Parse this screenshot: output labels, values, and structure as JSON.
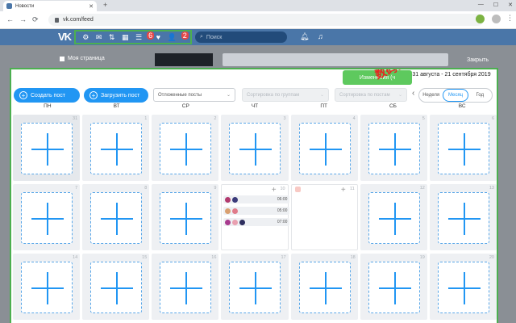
{
  "browser": {
    "tab_title": "Новости",
    "new_tab": "+",
    "url": "vk.com/feed",
    "controls": [
      "—",
      "☐",
      "✕"
    ]
  },
  "vk": {
    "logo": "VK",
    "icons": [
      "gear-icon",
      "mail-icon",
      "transfer-icon",
      "calendar-icon",
      "list-icon",
      "heart-icon",
      "user-icon"
    ],
    "list_badge": "6",
    "user_badge": "2",
    "search_placeholder": "Поиск"
  },
  "background": {
    "my_page": "Моя страница",
    "close": "Закрыть"
  },
  "watermark": "数码tscs66",
  "modal": {
    "apply_button": "Изменения (ч",
    "date_range": "31 августа - 21 сентября 2019",
    "create_post": "Создать пост",
    "upload_post": "Загрузить пост",
    "select_deferred": "Отложенные посты",
    "select_filter1": "Сортировка по группам",
    "select_filter2": "Сортировка по постам",
    "view_modes": [
      "Неделя",
      "Месяц",
      "Год"
    ],
    "active_view": "Месяц"
  },
  "calendar": {
    "weekdays": [
      "ПН",
      "ВТ",
      "СР",
      "ЧТ",
      "ПТ",
      "СБ",
      "ВС"
    ],
    "weeks": [
      [
        "31",
        "1",
        "2",
        "3",
        "4",
        "5",
        "6"
      ],
      [
        "7",
        "8",
        "9",
        "10",
        "11",
        "12",
        "13"
      ],
      [
        "14",
        "15",
        "16",
        "17",
        "18",
        "19",
        "20"
      ]
    ],
    "thursday_posts": [
      {
        "time": "06:00"
      },
      {
        "time": "05:00"
      },
      {
        "time": "07:00"
      }
    ]
  },
  "colors": {
    "vk_blue": "#4a76a8",
    "accent": "#2196f3",
    "apply_green": "#5ec95e",
    "highlight_border": "#4caf50"
  }
}
